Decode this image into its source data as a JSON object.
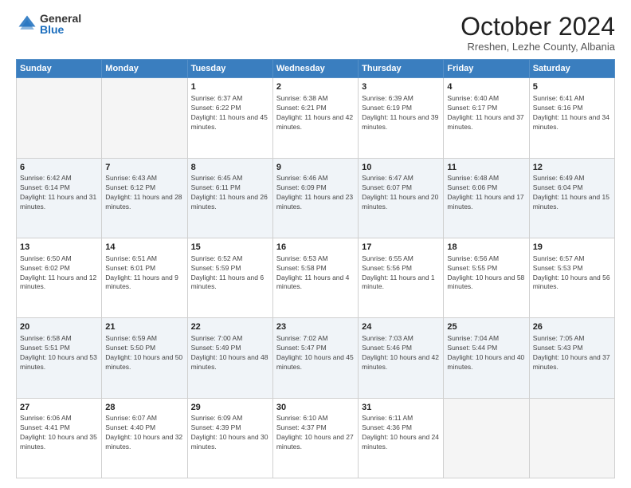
{
  "header": {
    "logo_general": "General",
    "logo_blue": "Blue",
    "month_title": "October 2024",
    "subtitle": "Rreshen, Lezhe County, Albania"
  },
  "days_of_week": [
    "Sunday",
    "Monday",
    "Tuesday",
    "Wednesday",
    "Thursday",
    "Friday",
    "Saturday"
  ],
  "weeks": [
    [
      {
        "day": "",
        "sunrise": "",
        "sunset": "",
        "daylight": ""
      },
      {
        "day": "",
        "sunrise": "",
        "sunset": "",
        "daylight": ""
      },
      {
        "day": "1",
        "sunrise": "Sunrise: 6:37 AM",
        "sunset": "Sunset: 6:22 PM",
        "daylight": "Daylight: 11 hours and 45 minutes."
      },
      {
        "day": "2",
        "sunrise": "Sunrise: 6:38 AM",
        "sunset": "Sunset: 6:21 PM",
        "daylight": "Daylight: 11 hours and 42 minutes."
      },
      {
        "day": "3",
        "sunrise": "Sunrise: 6:39 AM",
        "sunset": "Sunset: 6:19 PM",
        "daylight": "Daylight: 11 hours and 39 minutes."
      },
      {
        "day": "4",
        "sunrise": "Sunrise: 6:40 AM",
        "sunset": "Sunset: 6:17 PM",
        "daylight": "Daylight: 11 hours and 37 minutes."
      },
      {
        "day": "5",
        "sunrise": "Sunrise: 6:41 AM",
        "sunset": "Sunset: 6:16 PM",
        "daylight": "Daylight: 11 hours and 34 minutes."
      }
    ],
    [
      {
        "day": "6",
        "sunrise": "Sunrise: 6:42 AM",
        "sunset": "Sunset: 6:14 PM",
        "daylight": "Daylight: 11 hours and 31 minutes."
      },
      {
        "day": "7",
        "sunrise": "Sunrise: 6:43 AM",
        "sunset": "Sunset: 6:12 PM",
        "daylight": "Daylight: 11 hours and 28 minutes."
      },
      {
        "day": "8",
        "sunrise": "Sunrise: 6:45 AM",
        "sunset": "Sunset: 6:11 PM",
        "daylight": "Daylight: 11 hours and 26 minutes."
      },
      {
        "day": "9",
        "sunrise": "Sunrise: 6:46 AM",
        "sunset": "Sunset: 6:09 PM",
        "daylight": "Daylight: 11 hours and 23 minutes."
      },
      {
        "day": "10",
        "sunrise": "Sunrise: 6:47 AM",
        "sunset": "Sunset: 6:07 PM",
        "daylight": "Daylight: 11 hours and 20 minutes."
      },
      {
        "day": "11",
        "sunrise": "Sunrise: 6:48 AM",
        "sunset": "Sunset: 6:06 PM",
        "daylight": "Daylight: 11 hours and 17 minutes."
      },
      {
        "day": "12",
        "sunrise": "Sunrise: 6:49 AM",
        "sunset": "Sunset: 6:04 PM",
        "daylight": "Daylight: 11 hours and 15 minutes."
      }
    ],
    [
      {
        "day": "13",
        "sunrise": "Sunrise: 6:50 AM",
        "sunset": "Sunset: 6:02 PM",
        "daylight": "Daylight: 11 hours and 12 minutes."
      },
      {
        "day": "14",
        "sunrise": "Sunrise: 6:51 AM",
        "sunset": "Sunset: 6:01 PM",
        "daylight": "Daylight: 11 hours and 9 minutes."
      },
      {
        "day": "15",
        "sunrise": "Sunrise: 6:52 AM",
        "sunset": "Sunset: 5:59 PM",
        "daylight": "Daylight: 11 hours and 6 minutes."
      },
      {
        "day": "16",
        "sunrise": "Sunrise: 6:53 AM",
        "sunset": "Sunset: 5:58 PM",
        "daylight": "Daylight: 11 hours and 4 minutes."
      },
      {
        "day": "17",
        "sunrise": "Sunrise: 6:55 AM",
        "sunset": "Sunset: 5:56 PM",
        "daylight": "Daylight: 11 hours and 1 minute."
      },
      {
        "day": "18",
        "sunrise": "Sunrise: 6:56 AM",
        "sunset": "Sunset: 5:55 PM",
        "daylight": "Daylight: 10 hours and 58 minutes."
      },
      {
        "day": "19",
        "sunrise": "Sunrise: 6:57 AM",
        "sunset": "Sunset: 5:53 PM",
        "daylight": "Daylight: 10 hours and 56 minutes."
      }
    ],
    [
      {
        "day": "20",
        "sunrise": "Sunrise: 6:58 AM",
        "sunset": "Sunset: 5:51 PM",
        "daylight": "Daylight: 10 hours and 53 minutes."
      },
      {
        "day": "21",
        "sunrise": "Sunrise: 6:59 AM",
        "sunset": "Sunset: 5:50 PM",
        "daylight": "Daylight: 10 hours and 50 minutes."
      },
      {
        "day": "22",
        "sunrise": "Sunrise: 7:00 AM",
        "sunset": "Sunset: 5:49 PM",
        "daylight": "Daylight: 10 hours and 48 minutes."
      },
      {
        "day": "23",
        "sunrise": "Sunrise: 7:02 AM",
        "sunset": "Sunset: 5:47 PM",
        "daylight": "Daylight: 10 hours and 45 minutes."
      },
      {
        "day": "24",
        "sunrise": "Sunrise: 7:03 AM",
        "sunset": "Sunset: 5:46 PM",
        "daylight": "Daylight: 10 hours and 42 minutes."
      },
      {
        "day": "25",
        "sunrise": "Sunrise: 7:04 AM",
        "sunset": "Sunset: 5:44 PM",
        "daylight": "Daylight: 10 hours and 40 minutes."
      },
      {
        "day": "26",
        "sunrise": "Sunrise: 7:05 AM",
        "sunset": "Sunset: 5:43 PM",
        "daylight": "Daylight: 10 hours and 37 minutes."
      }
    ],
    [
      {
        "day": "27",
        "sunrise": "Sunrise: 6:06 AM",
        "sunset": "Sunset: 4:41 PM",
        "daylight": "Daylight: 10 hours and 35 minutes."
      },
      {
        "day": "28",
        "sunrise": "Sunrise: 6:07 AM",
        "sunset": "Sunset: 4:40 PM",
        "daylight": "Daylight: 10 hours and 32 minutes."
      },
      {
        "day": "29",
        "sunrise": "Sunrise: 6:09 AM",
        "sunset": "Sunset: 4:39 PM",
        "daylight": "Daylight: 10 hours and 30 minutes."
      },
      {
        "day": "30",
        "sunrise": "Sunrise: 6:10 AM",
        "sunset": "Sunset: 4:37 PM",
        "daylight": "Daylight: 10 hours and 27 minutes."
      },
      {
        "day": "31",
        "sunrise": "Sunrise: 6:11 AM",
        "sunset": "Sunset: 4:36 PM",
        "daylight": "Daylight: 10 hours and 24 minutes."
      },
      {
        "day": "",
        "sunrise": "",
        "sunset": "",
        "daylight": ""
      },
      {
        "day": "",
        "sunrise": "",
        "sunset": "",
        "daylight": ""
      }
    ]
  ]
}
